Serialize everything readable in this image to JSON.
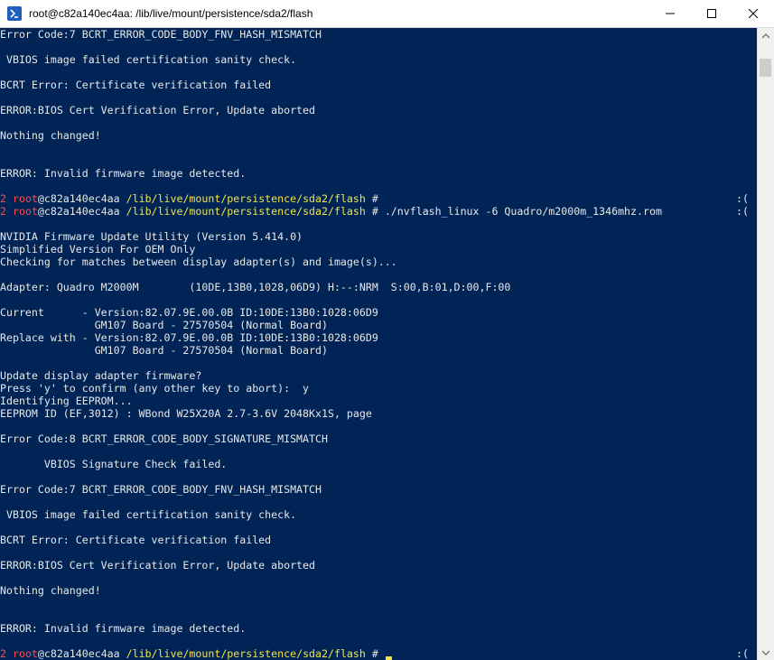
{
  "window": {
    "title": "root@c82a140ec4aa: /lib/live/mount/persistence/sda2/flash"
  },
  "icons": {
    "app": "powershell-icon",
    "minimize": "minimize-icon",
    "maximize": "maximize-icon",
    "close": "close-icon",
    "scroll_up": "chevron-up-icon",
    "scroll_down": "chevron-down-icon"
  },
  "colors": {
    "background": "#012456",
    "text": "#e8e8e8",
    "prompt_red": "#ff4d4d",
    "path_yellow": "#f0e34a"
  },
  "console": {
    "lines": [
      "Error Code:7 BCRT_ERROR_CODE_BODY_FNV_HASH_MISMATCH",
      "",
      " VBIOS image failed certification sanity check.",
      "",
      "BCRT Error: Certificate verification failed",
      "",
      "ERROR:BIOS Cert Verification Error, Update aborted",
      "",
      "Nothing changed!",
      "",
      "",
      "ERROR: Invalid firmware image detected.",
      "",
      "",
      "",
      "",
      "NVIDIA Firmware Update Utility (Version 5.414.0)",
      "Simplified Version For OEM Only",
      "Checking for matches between display adapter(s) and image(s)...",
      "",
      "Adapter: Quadro M2000M        (10DE,13B0,1028,06D9) H:--:NRM  S:00,B:01,D:00,F:00",
      "",
      "Current      - Version:82.07.9E.00.0B ID:10DE:13B0:1028:06D9",
      "               GM107 Board - 27570504 (Normal Board)",
      "Replace with - Version:82.07.9E.00.0B ID:10DE:13B0:1028:06D9",
      "               GM107 Board - 27570504 (Normal Board)",
      "",
      "Update display adapter firmware?",
      "Press 'y' to confirm (any other key to abort):  y",
      "Identifying EEPROM...",
      "EEPROM ID (EF,3012) : WBond W25X20A 2.7-3.6V 2048Kx1S, page",
      "",
      "Error Code:8 BCRT_ERROR_CODE_BODY_SIGNATURE_MISMATCH",
      "",
      "       VBIOS Signature Check failed.",
      "",
      "Error Code:7 BCRT_ERROR_CODE_BODY_FNV_HASH_MISMATCH",
      "",
      " VBIOS image failed certification sanity check.",
      "",
      "BCRT Error: Certificate verification failed",
      "",
      "ERROR:BIOS Cert Verification Error, Update aborted",
      "",
      "Nothing changed!",
      "",
      "",
      "ERROR: Invalid firmware image detected.",
      "",
      ""
    ],
    "prompts": [
      {
        "row": 13,
        "num": "2",
        "user": "root",
        "host": "@c82a140ec4aa",
        "path": "/lib/live/mount/persistence/sda2/flash",
        "cmd": " #",
        "status": ":("
      },
      {
        "row": 14,
        "num": "2",
        "user": "root",
        "host": "@c82a140ec4aa",
        "path": "/lib/live/mount/persistence/sda2/flash",
        "cmd": " # ./nvflash_linux -6 Quadro/m2000m_1346mhz.rom",
        "status": ":("
      },
      {
        "row": 49,
        "num": "2",
        "user": "root",
        "host": "@c82a140ec4aa",
        "path": "/lib/live/mount/persistence/sda2/flash",
        "cmd": " # ",
        "status": ":(",
        "cursor": true
      }
    ]
  }
}
